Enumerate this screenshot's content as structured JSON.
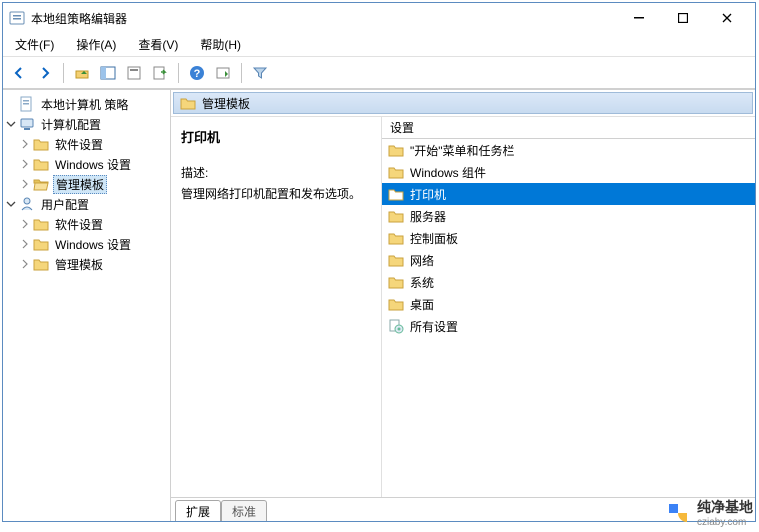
{
  "window": {
    "title": "本地组策略编辑器"
  },
  "menu": {
    "file": "文件(F)",
    "action": "操作(A)",
    "view": "查看(V)",
    "help": "帮助(H)"
  },
  "tree": {
    "root": "本地计算机 策略",
    "computer": "计算机配置",
    "c_soft": "软件设置",
    "c_win": "Windows 设置",
    "c_admin": "管理模板",
    "user": "用户配置",
    "u_soft": "软件设置",
    "u_win": "Windows 设置",
    "u_admin": "管理模板"
  },
  "path": {
    "title": "管理模板"
  },
  "desc": {
    "heading": "打印机",
    "label": "描述:",
    "text": "管理网络打印机配置和发布选项。"
  },
  "list": {
    "header": "设置",
    "items": {
      "0": "\"开始\"菜单和任务栏",
      "1": "Windows 组件",
      "2": "打印机",
      "3": "服务器",
      "4": "控制面板",
      "5": "网络",
      "6": "系统",
      "7": "桌面",
      "8": "所有设置"
    }
  },
  "tabs": {
    "ext": "扩展",
    "std": "标准"
  },
  "watermark": {
    "name": "纯净基地",
    "url": "cziaby.com"
  }
}
